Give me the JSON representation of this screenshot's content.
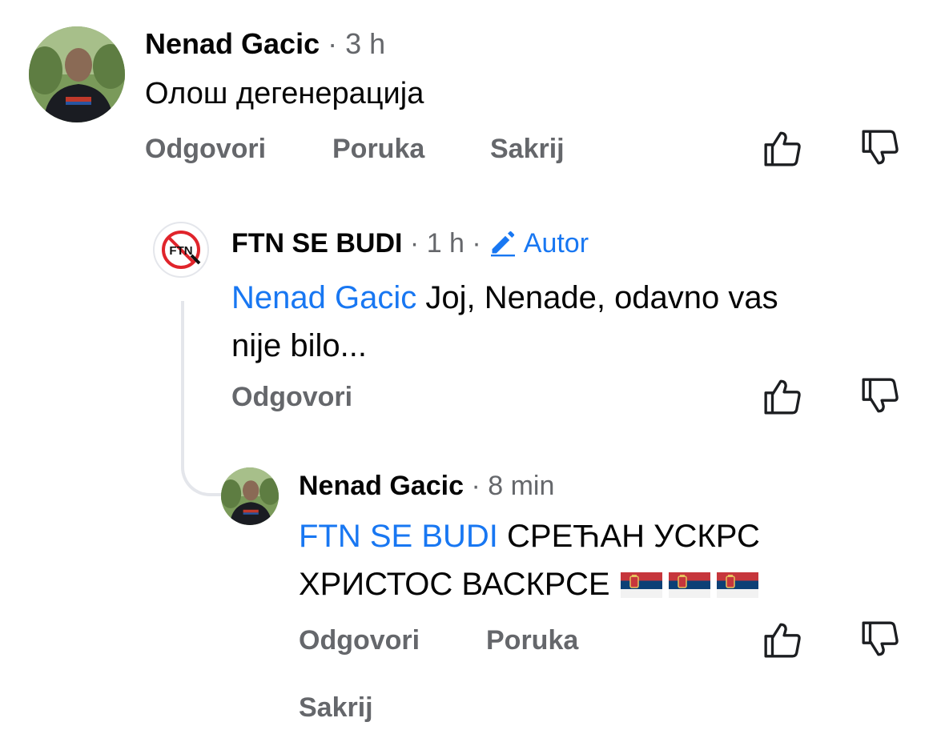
{
  "comments": [
    {
      "author": "Nenad Gacic",
      "time": "3 h",
      "text": "Олош дегенерација",
      "actions": {
        "reply": "Odgovori",
        "message": "Poruka",
        "hide": "Sakrij"
      }
    },
    {
      "author": "FTN SE BUDI",
      "time": "1 h",
      "badge": "Autor",
      "mention": "Nenad Gacic",
      "text_line1": "Joj, Nenade, odavno vas",
      "text_line2": "nije bilo...",
      "avatar_text": "FTN",
      "actions": {
        "reply": "Odgovori"
      }
    },
    {
      "author": "Nenad Gacic",
      "time": "8 min",
      "mention": "FTN SE BUDI",
      "text_line1": "СРЕЋАН УСКРС",
      "text_line2": "ХРИСТОС ВАСКРСЕ",
      "emoji": [
        "serbia-flag",
        "serbia-flag",
        "serbia-flag"
      ],
      "actions": {
        "reply": "Odgovori",
        "message": "Poruka",
        "hide": "Sakrij"
      }
    }
  ],
  "colors": {
    "link": "#1877f2",
    "meta": "#65676b",
    "text": "#050505",
    "thread": "#e4e6eb"
  },
  "icons": {
    "like": "thumbs-up-icon",
    "dislike": "thumbs-down-icon",
    "author_badge": "pencil-icon"
  }
}
